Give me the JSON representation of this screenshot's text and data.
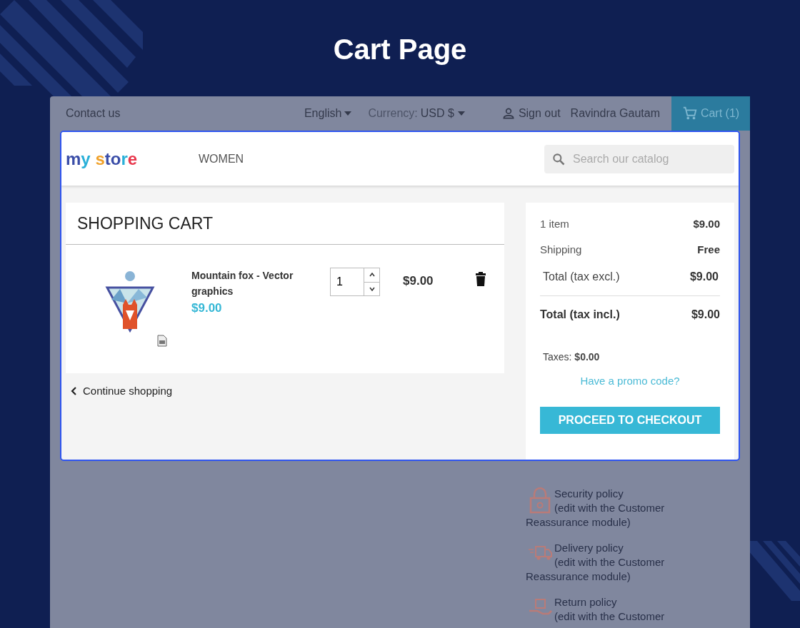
{
  "title": "Cart Page",
  "top_bar": {
    "contact": "Contact us",
    "language": "English",
    "currency_label": "Currency:",
    "currency": "USD $",
    "sign_out": "Sign out",
    "user": "Ravindra Gautam",
    "cart": "Cart (1)"
  },
  "header": {
    "logo": "my store",
    "menu": [
      "WOMEN"
    ],
    "search": {
      "placeholder": "Search our catalog"
    }
  },
  "cart": {
    "heading": "SHOPPING CART",
    "items": [
      {
        "name": "Mountain fox - Vector graphics",
        "unit_price": "$9.00",
        "quantity": "1",
        "total": "$9.00"
      }
    ],
    "continue": "Continue shopping"
  },
  "summary": {
    "rows": [
      {
        "label": "1 item",
        "value": "$9.00",
        "kind": "plain"
      },
      {
        "label": "Shipping",
        "value": "Free",
        "kind": "plain"
      },
      {
        "label": "Total (tax excl.)",
        "value": "$9.00",
        "kind": "indented"
      },
      {
        "label": "Total (tax incl.)",
        "value": "$9.00",
        "kind": "total"
      }
    ],
    "taxes": "Taxes: **$0.00**",
    "promo": "Have a promo code?",
    "checkout": "PROCEED TO CHECKOUT"
  },
  "policies": [
    {
      "kind": "lock",
      "title": "Security policy",
      "description": "(edit with the Customer",
      "description_2": "Reassurance module)"
    },
    {
      "kind": "truck",
      "title": "Delivery policy",
      "description": "(edit with the Customer",
      "description_2": "Reassurance module)"
    },
    {
      "kind": "parcel",
      "title": "Return policy",
      "description": "(edit with the Customer"
    }
  ]
}
